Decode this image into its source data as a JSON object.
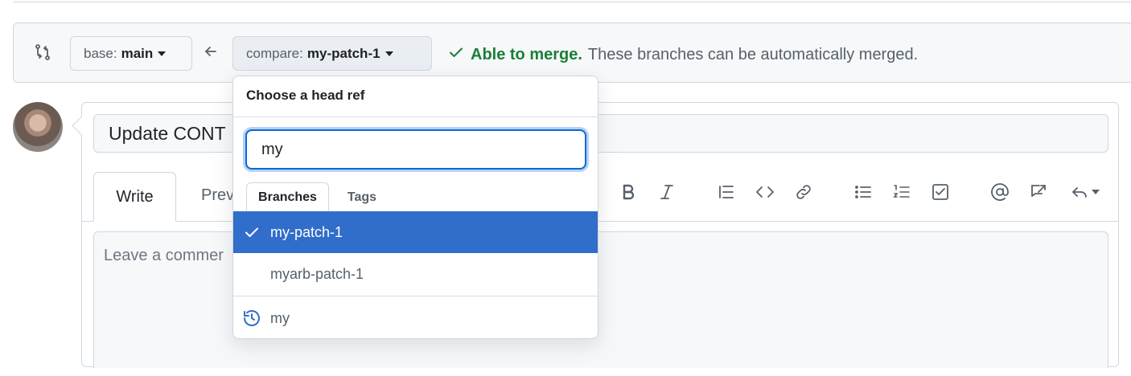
{
  "compare_bar": {
    "base_prefix": "base:",
    "base_branch": "main",
    "compare_prefix": "compare:",
    "compare_branch": "my-patch-1",
    "merge_ok": "Able to merge.",
    "merge_desc": "These branches can be automatically merged."
  },
  "pull_request": {
    "title_value": "Update CONT",
    "tabs": [
      "Write",
      "Prev"
    ],
    "body_placeholder": "Leave a commer"
  },
  "toolbar_icons": [
    "bold-icon",
    "italic-icon",
    "quote-icon",
    "code-icon",
    "link-icon",
    "unordered-list-icon",
    "ordered-list-icon",
    "task-list-icon",
    "mention-icon",
    "reference-icon",
    "reply-icon"
  ],
  "dropdown": {
    "header": "Choose a head ref",
    "filter_value": "my",
    "tabs": [
      "Branches",
      "Tags"
    ],
    "items": [
      {
        "label": "my-patch-1",
        "selected": true
      },
      {
        "label": "myarb-patch-1",
        "selected": false
      }
    ],
    "recent_item": "my"
  },
  "colors": {
    "success": "#1a7f37",
    "selected_bg": "#316dca",
    "focus": "#0969da"
  }
}
